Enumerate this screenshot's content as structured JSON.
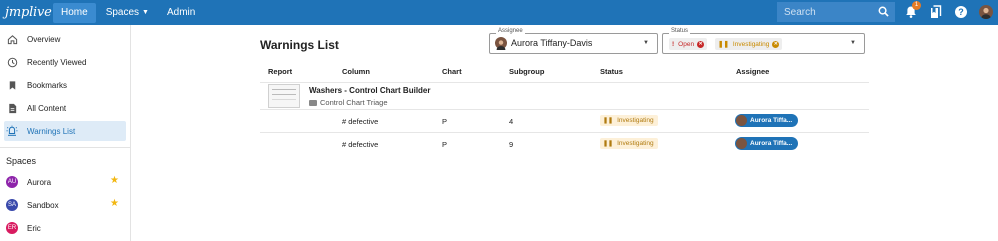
{
  "app": {
    "logo": "jmplive"
  },
  "topnav": {
    "home": "Home",
    "spaces": "Spaces",
    "admin": "Admin"
  },
  "search": {
    "placeholder": "Search"
  },
  "notifications": {
    "count": "1"
  },
  "sidebar": {
    "items": [
      {
        "label": "Overview",
        "icon": "home-icon"
      },
      {
        "label": "Recently Viewed",
        "icon": "clock-icon"
      },
      {
        "label": "Bookmarks",
        "icon": "bookmark-icon"
      },
      {
        "label": "All Content",
        "icon": "document-icon"
      },
      {
        "label": "Warnings List",
        "icon": "warning-icon",
        "selected": true
      }
    ],
    "spaces_heading": "Spaces",
    "spaces": [
      {
        "initials": "AU",
        "name": "Aurora",
        "color": "#8e24aa",
        "starred": true
      },
      {
        "initials": "SA",
        "name": "Sandbox",
        "color": "#3949ab",
        "starred": true
      },
      {
        "initials": "ER",
        "name": "Eric",
        "color": "#d81b60",
        "starred": false
      }
    ]
  },
  "page": {
    "title": "Warnings List"
  },
  "filters": {
    "assignee": {
      "legend": "Assignee",
      "value": "Aurora Tiffany-Davis"
    },
    "status": {
      "legend": "Status",
      "chips": [
        "Open",
        "Investigating"
      ]
    }
  },
  "table": {
    "headers": [
      "Report",
      "Column",
      "Chart",
      "Subgroup",
      "Status",
      "Assignee"
    ],
    "report": {
      "name": "Washers - Control Chart Builder",
      "folder": "Control Chart Triage"
    },
    "rows": [
      {
        "column": "# defective",
        "chart": "P",
        "subgroup": "4",
        "status": "Investigating",
        "assignee": "Aurora Tiffa..."
      },
      {
        "column": "# defective",
        "chart": "P",
        "subgroup": "9",
        "status": "Investigating",
        "assignee": "Aurora Tiffa..."
      }
    ]
  },
  "colors": {
    "brand": "#1f73b7",
    "open": "#c62828",
    "investigating": "#c98a00",
    "star": "#f2b712"
  }
}
